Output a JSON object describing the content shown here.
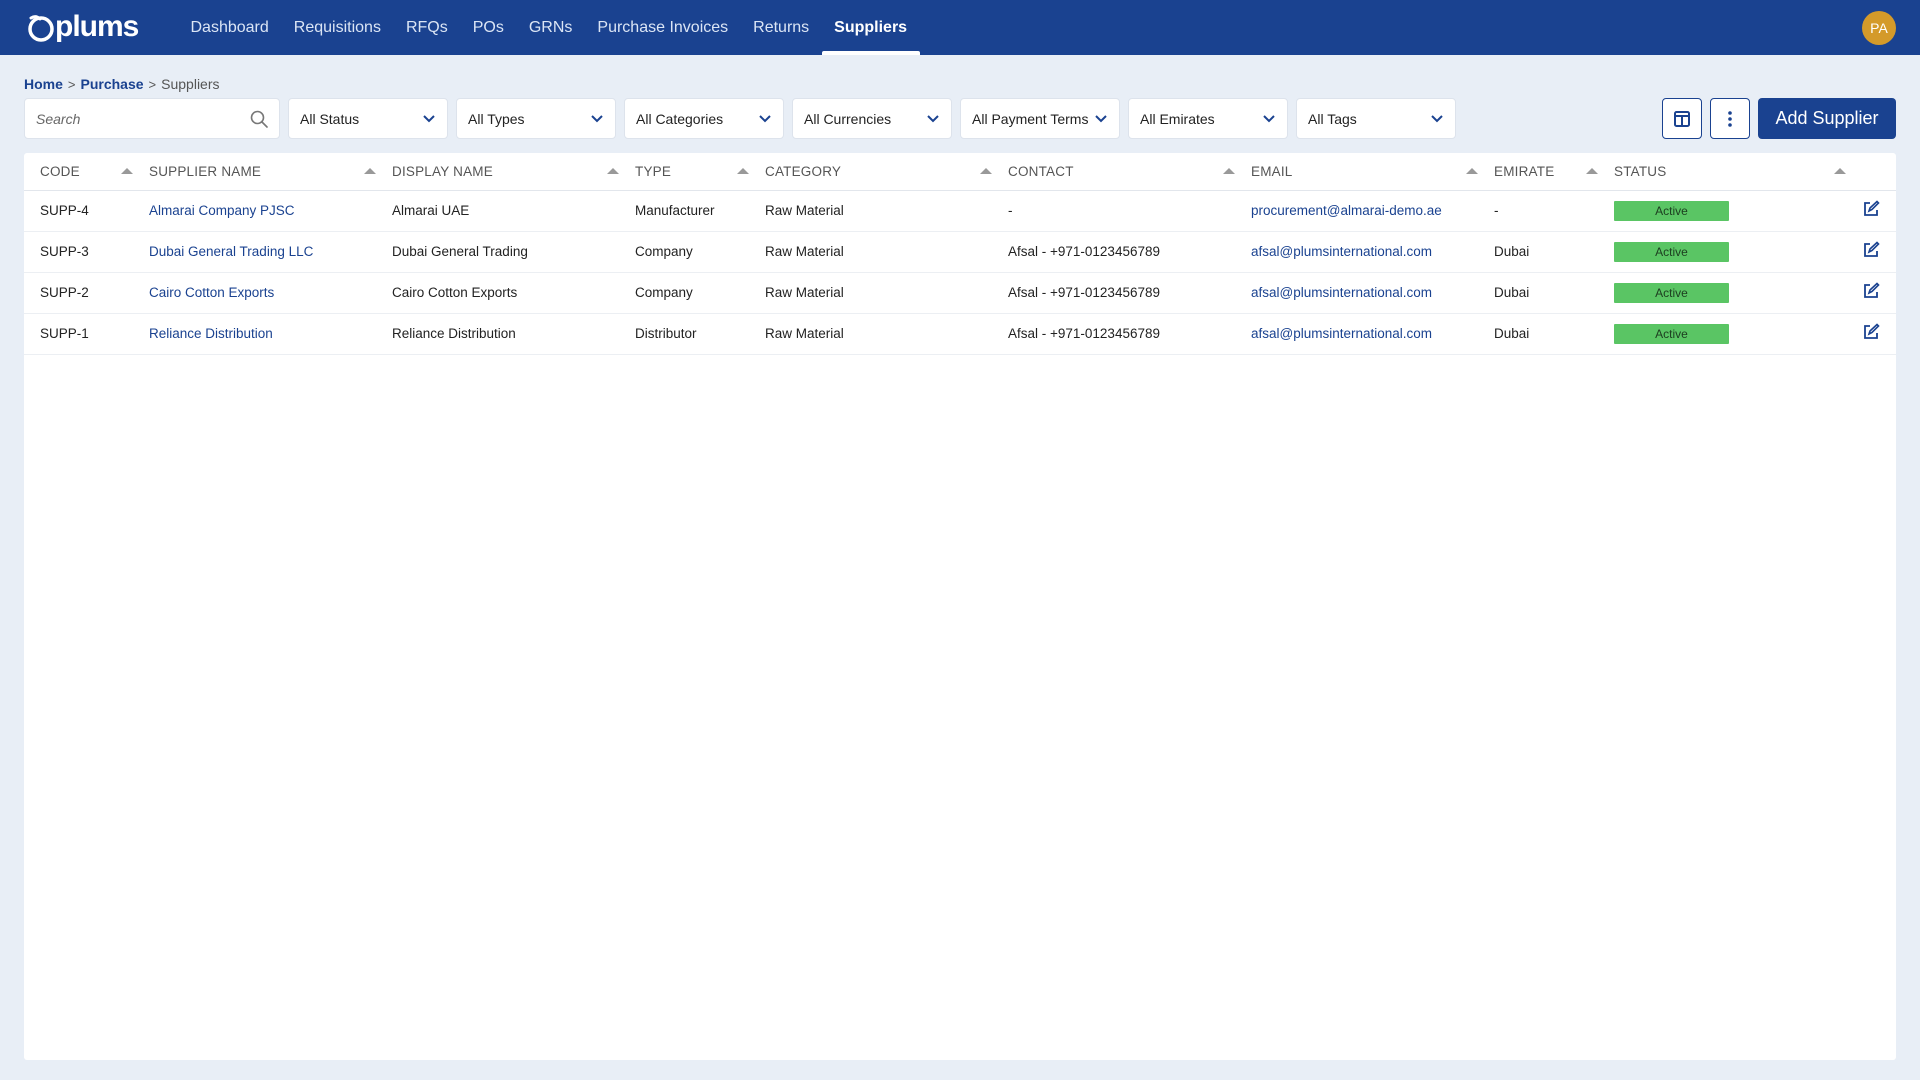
{
  "app": {
    "logo_text": "plums",
    "nav": [
      {
        "label": "Dashboard"
      },
      {
        "label": "Requisitions"
      },
      {
        "label": "RFQs"
      },
      {
        "label": "POs"
      },
      {
        "label": "GRNs"
      },
      {
        "label": "Purchase Invoices"
      },
      {
        "label": "Returns"
      },
      {
        "label": "Suppliers",
        "active": true
      }
    ],
    "user_initials": "PA"
  },
  "breadcrumb": {
    "home": "Home",
    "purchase": "Purchase",
    "current": "Suppliers",
    "separator": ">"
  },
  "filters": {
    "search_placeholder": "Search",
    "status": "All Status",
    "types": "All Types",
    "categories": "All Categories",
    "currencies": "All Currencies",
    "payment_terms": "All Payment Terms",
    "emirates": "All Emirates",
    "tags": "All Tags"
  },
  "actions": {
    "add_supplier": "Add Supplier"
  },
  "table": {
    "columns": [
      "CODE",
      "SUPPLIER NAME",
      "DISPLAY NAME",
      "TYPE",
      "CATEGORY",
      "CONTACT",
      "EMAIL",
      "EMIRATE",
      "STATUS"
    ],
    "rows": [
      {
        "code": "SUPP-4",
        "supplier_name": "Almarai Company PJSC",
        "display_name": "Almarai UAE",
        "type": "Manufacturer",
        "category": "Raw Material",
        "contact": "-",
        "email": "procurement@almarai-demo.ae",
        "emirate": "-",
        "status": "Active"
      },
      {
        "code": "SUPP-3",
        "supplier_name": "Dubai General Trading LLC",
        "display_name": "Dubai General Trading",
        "type": "Company",
        "category": "Raw Material",
        "contact": "Afsal - +971-0123456789",
        "email": "afsal@plumsinternational.com",
        "emirate": "Dubai",
        "status": "Active"
      },
      {
        "code": "SUPP-2",
        "supplier_name": "Cairo Cotton Exports",
        "display_name": "Cairo Cotton Exports",
        "type": "Company",
        "category": "Raw Material",
        "contact": "Afsal - +971-0123456789",
        "email": "afsal@plumsinternational.com",
        "emirate": "Dubai",
        "status": "Active"
      },
      {
        "code": "SUPP-1",
        "supplier_name": "Reliance Distribution",
        "display_name": "Reliance Distribution",
        "type": "Distributor",
        "category": "Raw Material",
        "contact": "Afsal - +971-0123456789",
        "email": "afsal@plumsinternational.com",
        "emirate": "Dubai",
        "status": "Active"
      }
    ]
  },
  "colors": {
    "brand": "#1a4290",
    "status_active": "#5ac564",
    "avatar": "#d49a2a"
  }
}
